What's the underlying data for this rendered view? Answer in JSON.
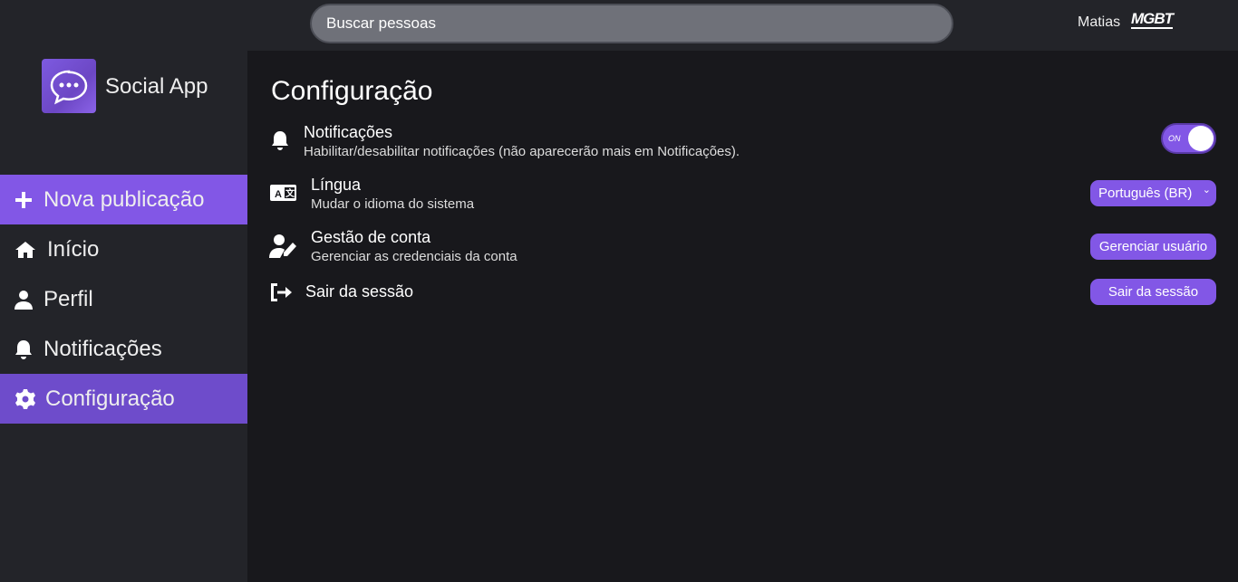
{
  "topbar": {
    "search_placeholder": "Buscar pessoas",
    "user_name": "Matias",
    "user_logo_text": "MGBT"
  },
  "sidebar": {
    "brand": "Social App",
    "items": [
      {
        "label": "Nova publicação",
        "icon": "plus-icon"
      },
      {
        "label": "Início",
        "icon": "home-icon"
      },
      {
        "label": "Perfil",
        "icon": "user-icon"
      },
      {
        "label": "Notificações",
        "icon": "bell-icon"
      },
      {
        "label": "Configuração",
        "icon": "gear-icon",
        "active": true
      }
    ]
  },
  "main": {
    "title": "Configuração",
    "settings": {
      "notifications": {
        "title": "Notificações",
        "desc": "Habilitar/desabilitar notificações (não aparecerão mais em Notificações).",
        "toggle_label": "ON",
        "enabled": true
      },
      "language": {
        "title": "Língua",
        "desc": "Mudar o idioma do sistema",
        "selected": "Português (BR)"
      },
      "account": {
        "title": "Gestão de conta",
        "desc": "Gerenciar as credenciais da conta",
        "button": "Gerenciar usuário"
      },
      "logout": {
        "title": "Sair da sessão",
        "button": "Sair da sessão"
      }
    }
  },
  "colors": {
    "accent": "#8257e6",
    "active": "#6e4ccb",
    "background": "#18181c",
    "panel": "#232429"
  }
}
